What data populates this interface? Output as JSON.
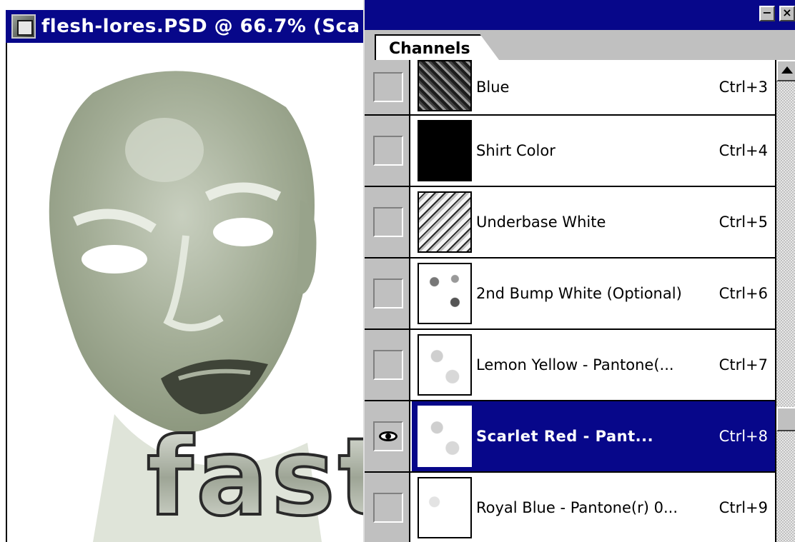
{
  "document": {
    "title": "flesh-lores.PSD @ 66.7% (Sca",
    "canvas_text": "fast"
  },
  "palette": {
    "minimize_label": "−",
    "close_label": "×",
    "tab_label": "Channels",
    "channels": [
      {
        "name": "Blue",
        "shortcut": "Ctrl+3",
        "visible": false,
        "selected": false
      },
      {
        "name": "Shirt Color",
        "shortcut": "Ctrl+4",
        "visible": false,
        "selected": false
      },
      {
        "name": "Underbase White",
        "shortcut": "Ctrl+5",
        "visible": false,
        "selected": false
      },
      {
        "name": "2nd Bump White (Optional)",
        "shortcut": "Ctrl+6",
        "visible": false,
        "selected": false
      },
      {
        "name": "Lemon Yellow - Pantone(...",
        "shortcut": "Ctrl+7",
        "visible": false,
        "selected": false
      },
      {
        "name": "Scarlet Red - Pant...",
        "shortcut": "Ctrl+8",
        "visible": true,
        "selected": true
      },
      {
        "name": "Royal Blue - Pantone(r) 0...",
        "shortcut": "Ctrl+9",
        "visible": false,
        "selected": false
      }
    ]
  },
  "colors": {
    "titlebar": "#07078a",
    "selection": "#07078a",
    "chrome": "#c0c0c0",
    "image_tint": "#a3ad96"
  },
  "icons": {
    "document": "photoshop-document-icon",
    "visibility": "eye-icon",
    "palette_menu": "triangle-right-icon",
    "scroll_up": "arrow-up-icon"
  }
}
